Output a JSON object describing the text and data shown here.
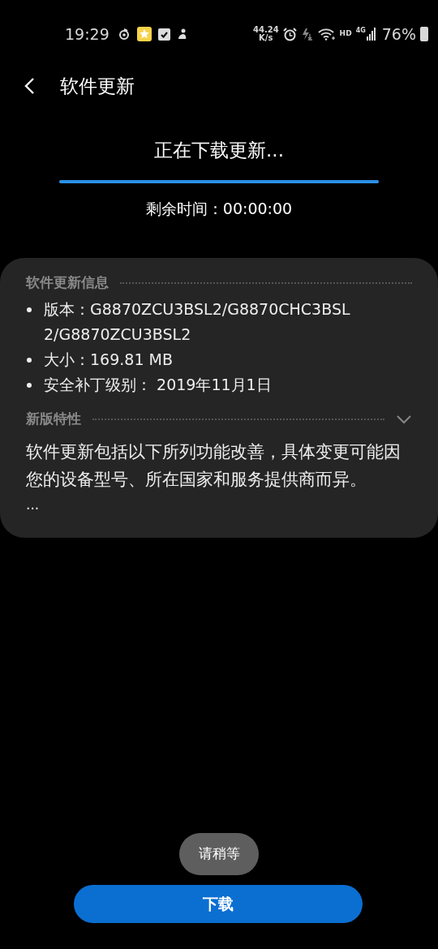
{
  "status_bar": {
    "time": "19:29",
    "net_speed": "44.24",
    "net_unit": "K/s",
    "hd": "HD",
    "network": "4G",
    "battery": "76%"
  },
  "header": {
    "title": "软件更新"
  },
  "download": {
    "title": "正在下载更新...",
    "level": 1,
    "remaining": "剩余时间：00:00:00"
  },
  "info": {
    "heading": "软件更新信息",
    "items": [
      "版本：G8870ZCU3BSL2/G8870CHC3BSL2/G8870ZCU3BSL2",
      "大小：169.81 MB",
      "安全补丁级别： 2019年11月1日"
    ]
  },
  "features": {
    "heading": "新版特性",
    "expanded": false,
    "text": "软件更新包括以下所列功能改善，具体变更可能因您的设备型号、所在国家和服务提供商而异。",
    "more": "..."
  },
  "toast": "请稍等",
  "button": "下载"
}
